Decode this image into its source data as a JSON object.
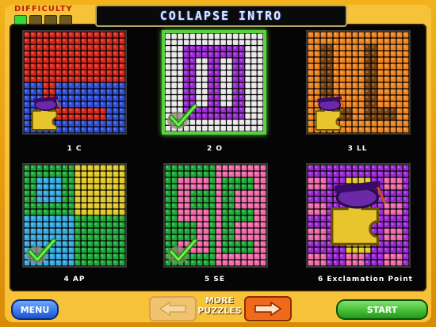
{
  "header": {
    "difficulty_label": "DIFFICULTY",
    "difficulty_level": 1,
    "difficulty_max": 4,
    "title": "COLLAPSE INTRO"
  },
  "puzzles": [
    {
      "label": "1   C",
      "completed": false,
      "selected": false,
      "mascot": true
    },
    {
      "label": "2   O",
      "completed": true,
      "selected": true,
      "mascot": false
    },
    {
      "label": "3   LL",
      "completed": false,
      "selected": false,
      "mascot": true
    },
    {
      "label": "4   AP",
      "completed": true,
      "selected": false,
      "mascot": false
    },
    {
      "label": "5   SE",
      "completed": true,
      "selected": false,
      "mascot": false
    },
    {
      "label": "6   Exclamation Point",
      "completed": false,
      "selected": false,
      "mascot": true
    }
  ],
  "footer": {
    "menu_label": "MENU",
    "more_line1": "MORE",
    "more_line2": "PUZZLES",
    "start_label": "START"
  },
  "colors": {
    "red": "#d8271b",
    "blue": "#2f4fd6",
    "white": "#e8e8e8",
    "purple": "#9b2bd2",
    "orange": "#ee8420",
    "brown": "#7a4212",
    "green": "#21a83a",
    "yellow": "#e0c72a",
    "lightblue": "#38a8e0",
    "pink": "#ee6aa8",
    "lime": "#5cd13f"
  }
}
